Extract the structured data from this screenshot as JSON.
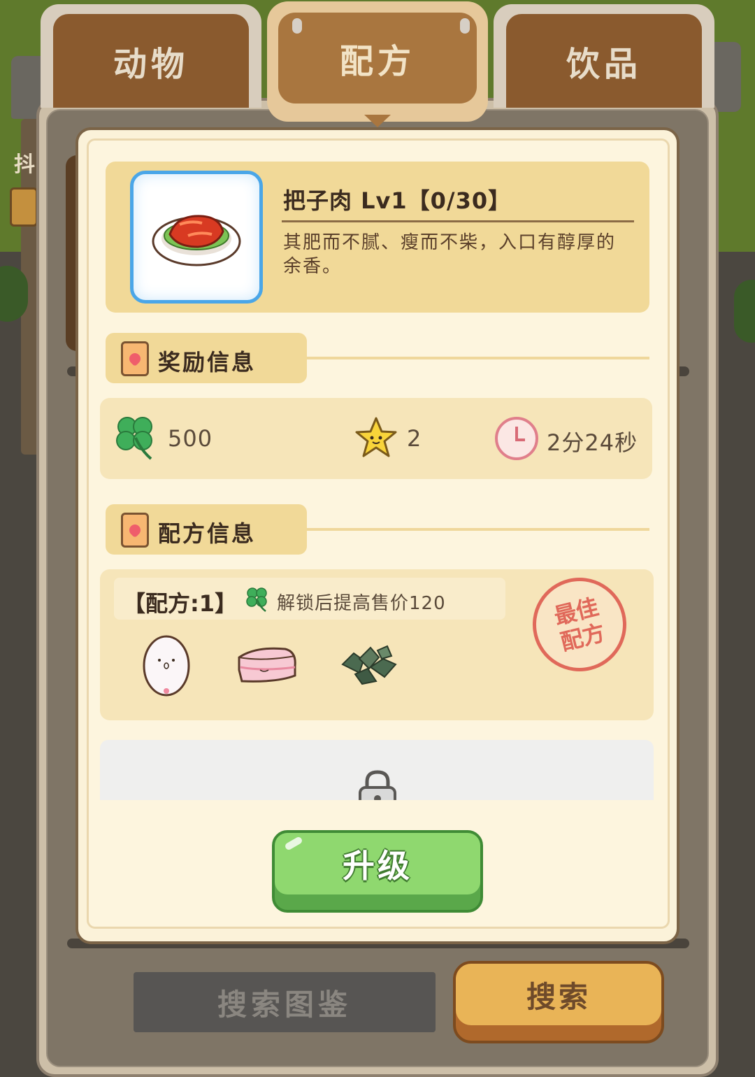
{
  "tabs": [
    {
      "label": "动物",
      "active": false
    },
    {
      "label": "配方",
      "active": true
    },
    {
      "label": "饮品",
      "active": false
    }
  ],
  "background": {
    "sign_text": "抖"
  },
  "dish": {
    "icon": "braised-pork-plate",
    "title": "把子肉 Lv1【0/30】",
    "description": "其肥而不腻、瘦而不柴，入口有醇厚的余香。"
  },
  "sections": {
    "reward_title": "奖励信息",
    "recipe_title": "配方信息"
  },
  "rewards": {
    "clover": {
      "icon": "clover-icon",
      "value": "500"
    },
    "star": {
      "icon": "star-icon",
      "value": "2"
    },
    "time": {
      "icon": "clock-icon",
      "value": "2分24秒"
    }
  },
  "recipe": {
    "label": "【配方:1】",
    "bonus_text": "解锁后提高售价120",
    "ingredients": [
      "egg",
      "pork-belly",
      "dried-leaves"
    ],
    "stamp_line1": "最佳",
    "stamp_line2": "配方"
  },
  "buttons": {
    "upgrade": "升级",
    "catalog": "搜索图鉴",
    "search": "搜索"
  },
  "colors": {
    "accent_green": "#8fd86f",
    "tab_brown": "#a9763f",
    "panel_yellow": "#f1d998",
    "stamp_red": "#e0695a"
  }
}
